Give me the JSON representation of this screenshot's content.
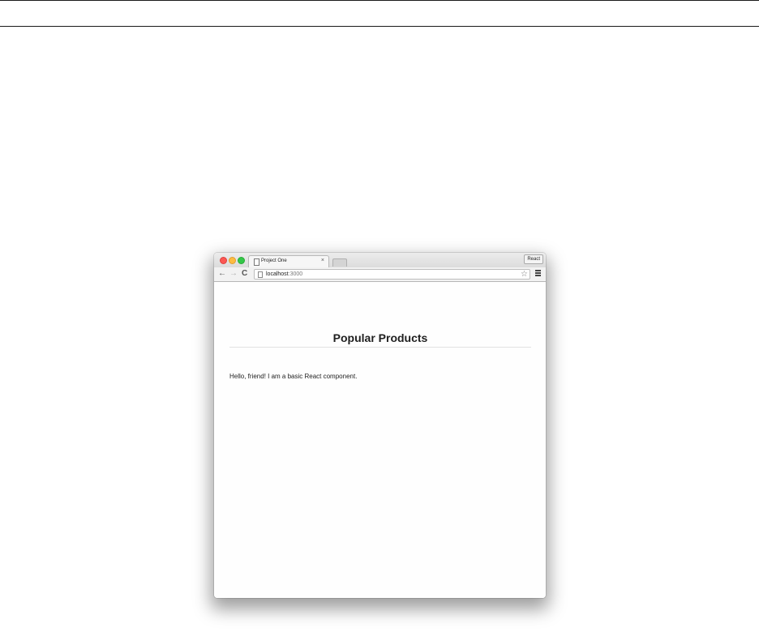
{
  "browser": {
    "tab_title": "Project One",
    "tab_close": "×",
    "profile_button": "React",
    "url_host": "localhost",
    "url_port": ":3000",
    "icons": {
      "back": "←",
      "forward": "→",
      "reload": "C",
      "star": "☆"
    }
  },
  "page": {
    "heading": "Popular Products",
    "text": "Hello, friend! I am a basic React component."
  }
}
